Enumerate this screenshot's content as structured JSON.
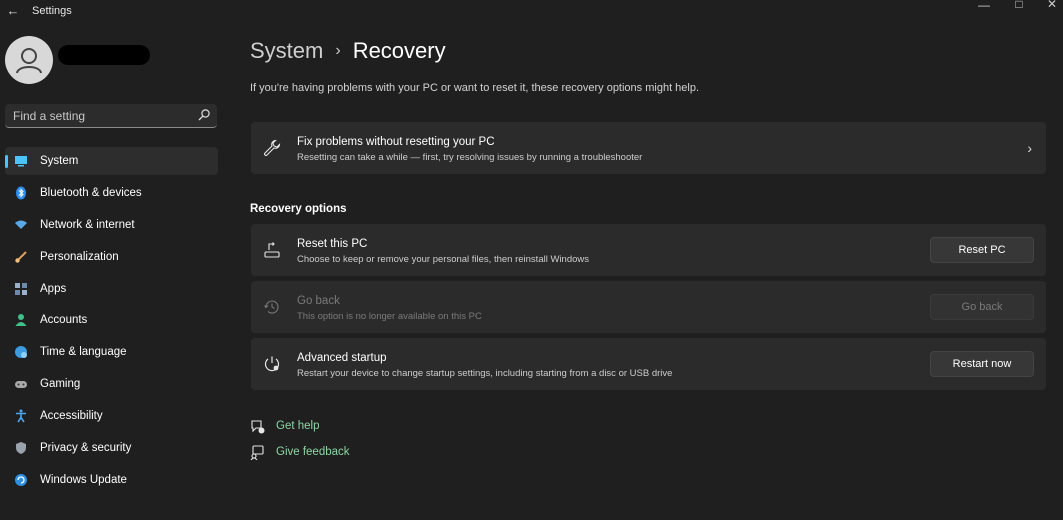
{
  "window": {
    "title": "Settings"
  },
  "sidebar": {
    "search_placeholder": "Find a setting",
    "items": [
      {
        "label": "System",
        "icon": "system-icon",
        "active": true
      },
      {
        "label": "Bluetooth & devices",
        "icon": "bluetooth-icon"
      },
      {
        "label": "Network & internet",
        "icon": "wifi-icon"
      },
      {
        "label": "Personalization",
        "icon": "brush-icon"
      },
      {
        "label": "Apps",
        "icon": "apps-icon"
      },
      {
        "label": "Accounts",
        "icon": "accounts-icon"
      },
      {
        "label": "Time & language",
        "icon": "globe-clock-icon"
      },
      {
        "label": "Gaming",
        "icon": "gamepad-icon"
      },
      {
        "label": "Accessibility",
        "icon": "accessibility-icon"
      },
      {
        "label": "Privacy & security",
        "icon": "shield-icon"
      },
      {
        "label": "Windows Update",
        "icon": "update-icon"
      }
    ]
  },
  "header": {
    "parent": "System",
    "separator": "›",
    "current": "Recovery"
  },
  "main": {
    "subtitle": "If you're having problems with your PC or want to reset it, these recovery options might help.",
    "fix_card": {
      "title": "Fix problems without resetting your PC",
      "desc": "Resetting can take a while — first, try resolving issues by running a troubleshooter"
    },
    "section_title": "Recovery options",
    "options": [
      {
        "title": "Reset this PC",
        "desc": "Choose to keep or remove your personal files, then reinstall Windows",
        "button": "Reset PC",
        "disabled": false
      },
      {
        "title": "Go back",
        "desc": "This option is no longer available on this PC",
        "button": "Go back",
        "disabled": true
      },
      {
        "title": "Advanced startup",
        "desc": "Restart your device to change startup settings, including starting from a disc or USB drive",
        "button": "Restart now",
        "disabled": false
      }
    ],
    "links": [
      {
        "label": "Get help",
        "icon": "help-chat-icon"
      },
      {
        "label": "Give feedback",
        "icon": "feedback-icon"
      }
    ]
  },
  "colors": {
    "accent": "#4cc2ff",
    "link": "#8fd6a4",
    "background": "#1f1f1f",
    "card": "#2b2b2b"
  }
}
